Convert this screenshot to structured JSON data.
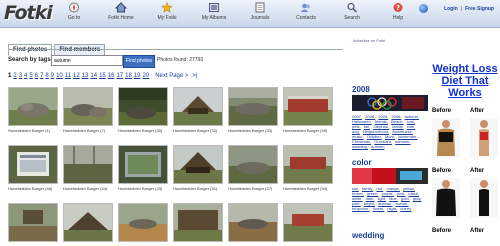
{
  "app": {
    "logo": "Fotki"
  },
  "nav": [
    {
      "label": "Go to"
    },
    {
      "label": "Fotki Home"
    },
    {
      "label": "My Fotki"
    },
    {
      "label": "My Albums"
    },
    {
      "label": "Journals"
    },
    {
      "label": "Contacts"
    },
    {
      "label": "Search"
    },
    {
      "label": "Help"
    }
  ],
  "login": {
    "login_label": "Login",
    "signup_label": "Free Signup"
  },
  "tabs": [
    {
      "label": "Find photos"
    },
    {
      "label": "Find members"
    }
  ],
  "search": {
    "label": "Search by tags:",
    "value": "autumn",
    "button": "Find photos",
    "found": "Photos found: 27793"
  },
  "pager": {
    "pages": [
      "1",
      "2",
      "3",
      "4",
      "5",
      "6",
      "7",
      "8",
      "9",
      "10",
      "11",
      "12",
      "13",
      "14",
      "15",
      "16",
      "17",
      "18",
      "19",
      "20"
    ],
    "current": "1",
    "next": "Next Page >",
    "last": ">|"
  },
  "photos": [
    {
      "caption": "Hunebedden Borger (1)"
    },
    {
      "caption": "Hunebedden Borger (7)"
    },
    {
      "caption": "Hunebedden Borger (30)"
    },
    {
      "caption": "Hunebedden Borger (32)"
    },
    {
      "caption": "Hunebedden Borger (33)"
    },
    {
      "caption": "Hunebedden Borger (49)"
    },
    {
      "caption": "Hunebedden Borger (46)"
    },
    {
      "caption": "Hunebedden Borger (44)"
    },
    {
      "caption": "Hunebedden Borger (43)"
    },
    {
      "caption": "Hunebedden Borger (51)"
    },
    {
      "caption": "Hunebedden Borger (37)"
    },
    {
      "caption": "Hunebedden Borger (34)"
    },
    {
      "caption": ""
    },
    {
      "caption": ""
    },
    {
      "caption": ""
    },
    {
      "caption": ""
    },
    {
      "caption": ""
    },
    {
      "caption": ""
    }
  ],
  "sidebar": {
    "advert_label": "Advertise on Fotki",
    "year_heading": "2008",
    "year_tags": [
      "2007,",
      "2008,",
      "2005,",
      "2006,",
      "autumn,",
      "Halloween,",
      "friends,",
      "Beach,",
      "cool,",
      "pets,",
      "fall,",
      "Stephan,",
      "family,",
      "cute,",
      "dog,",
      "Neighborhood,",
      "Awareness,",
      "music,",
      "October,",
      "Mom,",
      "November,",
      "Christmas,",
      "Gumbaro,",
      "summer,",
      "wedding,",
      "autumn"
    ],
    "color_heading": "color",
    "color_tags": [
      "sky,",
      "family,",
      "red,",
      "orange,",
      "yellow,",
      "brown,",
      "green,",
      "purple,",
      "pink,",
      "black,",
      "white,",
      "dark,",
      "light,",
      "blue,",
      "gold,",
      "gray,",
      "pale,",
      "bright,",
      "autumn,",
      "sunset,",
      "turquoise,",
      "flower,",
      "night,",
      "cherry"
    ],
    "wedding_heading": "wedding"
  },
  "ad": {
    "headline": "Weight Loss Diet That Works",
    "before_label": "Before",
    "after_label": "After"
  },
  "colors": {
    "link": "#1a3e9a",
    "button": "#3b6fc0",
    "ad_headline": "#1330d0"
  },
  "icons": [
    "compass-icon",
    "home-icon",
    "star-icon",
    "album-icon",
    "journal-icon",
    "contacts-icon",
    "search-icon",
    "help-icon",
    "globe-icon"
  ]
}
